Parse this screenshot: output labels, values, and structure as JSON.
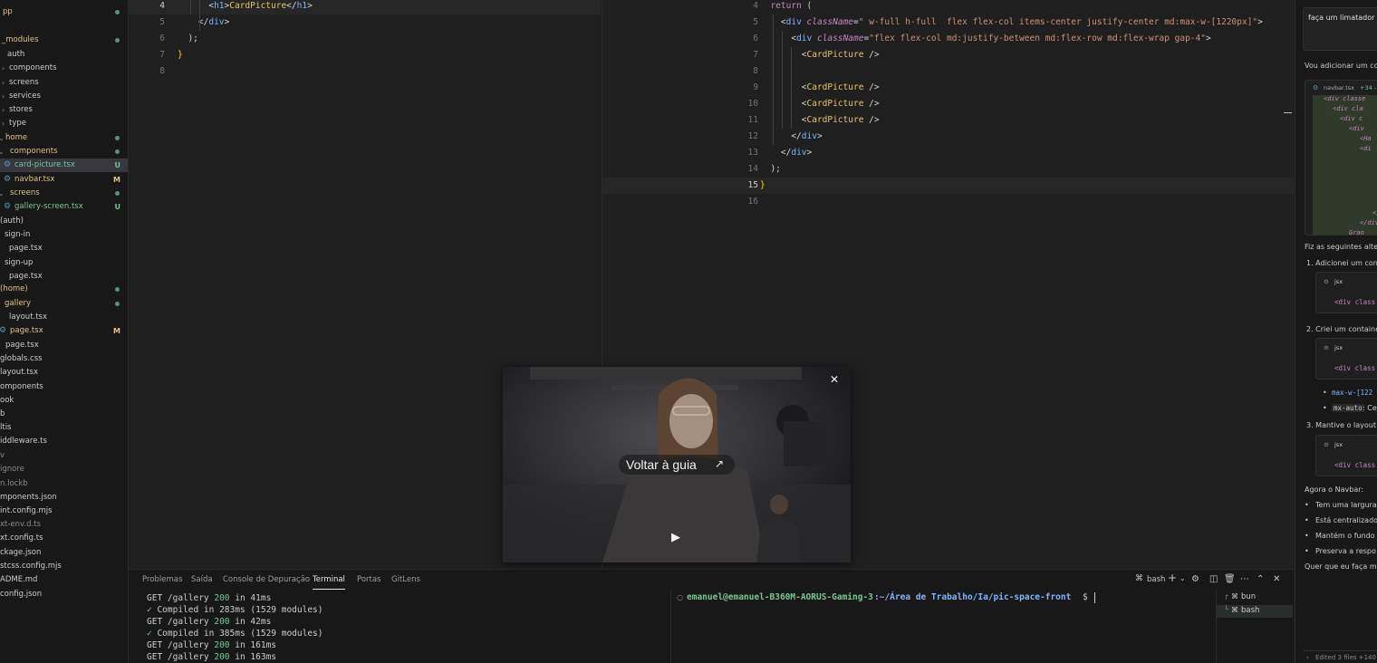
{
  "explorer": {
    "items": [
      {
        "label": "pp",
        "status": "dot"
      },
      {
        "label": "_modules",
        "status": "dot"
      },
      {
        "label": "auth",
        "chevron": "down"
      },
      {
        "label": "components",
        "chevron": "right"
      },
      {
        "label": "screens",
        "chevron": "right"
      },
      {
        "label": "services",
        "chevron": "right"
      },
      {
        "label": "stores",
        "chevron": "right"
      },
      {
        "label": "type",
        "chevron": "right"
      },
      {
        "label": "home",
        "chevron": "down",
        "status": "dot"
      },
      {
        "label": "components",
        "chevron": "down",
        "status": "dot"
      },
      {
        "label": "card-picture.tsx",
        "status": "U"
      },
      {
        "label": "navbar.tsx",
        "status": "M"
      },
      {
        "label": "screens",
        "chevron": "down",
        "status": "dot"
      },
      {
        "label": "gallery-screen.tsx",
        "status": "U"
      },
      {
        "label": "(auth)"
      },
      {
        "label": "sign-in",
        "chevron": "down"
      },
      {
        "label": "page.tsx"
      },
      {
        "label": "sign-up",
        "chevron": "down"
      },
      {
        "label": "page.tsx"
      },
      {
        "label": "(home)",
        "status": "dot"
      },
      {
        "label": "gallery",
        "status": "dot"
      },
      {
        "label": "layout.tsx"
      },
      {
        "label": "page.tsx",
        "status": "M"
      },
      {
        "label": "page.tsx"
      },
      {
        "label": "globals.css"
      },
      {
        "label": "layout.tsx"
      },
      {
        "label": "omponents"
      },
      {
        "label": "ook"
      },
      {
        "label": "b"
      },
      {
        "label": "ltis"
      },
      {
        "label": "iddleware.ts"
      },
      {
        "label": "v"
      },
      {
        "label": "ignore"
      },
      {
        "label": "n.lockb"
      },
      {
        "label": "mponents.json"
      },
      {
        "label": "int.config.mjs"
      },
      {
        "label": "xt-env.d.ts"
      },
      {
        "label": "xt.config.ts"
      },
      {
        "label": "ckage.json"
      },
      {
        "label": "stcss.config.mjs"
      },
      {
        "label": "ADME.md"
      },
      {
        "label": "config.json"
      }
    ]
  },
  "editor_left": {
    "lines": [
      {
        "n": "4",
        "tokens": [
          [
            "      ",
            ""
          ],
          [
            "<",
            "punc"
          ],
          [
            "h1",
            "tag"
          ],
          [
            ">",
            "punc"
          ],
          [
            "CardPicture",
            "text"
          ],
          [
            "</",
            "punc"
          ],
          [
            "h1",
            "tag"
          ],
          [
            ">",
            "punc"
          ]
        ]
      },
      {
        "n": "5",
        "tokens": [
          [
            "    ",
            ""
          ],
          [
            "</",
            "punc"
          ],
          [
            "div",
            "tag"
          ],
          [
            ">",
            "punc"
          ]
        ]
      },
      {
        "n": "6",
        "tokens": [
          [
            "  ",
            ""
          ],
          [
            ");",
            "punc"
          ]
        ]
      },
      {
        "n": "7",
        "tokens": [
          [
            "}",
            "brace"
          ]
        ]
      },
      {
        "n": "8",
        "tokens": []
      }
    ]
  },
  "editor_right": {
    "lines": [
      {
        "n": "4",
        "tokens": [
          [
            "  ",
            ""
          ],
          [
            "return",
            "kw"
          ],
          [
            " (",
            "punc"
          ]
        ]
      },
      {
        "n": "5",
        "tokens": [
          [
            "    ",
            ""
          ],
          [
            "<",
            "punc"
          ],
          [
            "div",
            "tag"
          ],
          [
            " ",
            ""
          ],
          [
            "className",
            "attr"
          ],
          [
            "=",
            "punc"
          ],
          [
            "\" w-full h-full  flex flex-col items-center justify-center md:max-w-[1220px]\"",
            "str"
          ],
          [
            ">",
            "punc"
          ]
        ]
      },
      {
        "n": "6",
        "tokens": [
          [
            "      ",
            ""
          ],
          [
            "<",
            "punc"
          ],
          [
            "div",
            "tag"
          ],
          [
            " ",
            ""
          ],
          [
            "className",
            "attr"
          ],
          [
            "=",
            "punc"
          ],
          [
            "\"flex flex-col md:justify-between md:flex-row md:flex-wrap gap-4\"",
            "str"
          ],
          [
            ">",
            "punc"
          ]
        ]
      },
      {
        "n": "7",
        "tokens": [
          [
            "        ",
            ""
          ],
          [
            "<",
            "punc"
          ],
          [
            "CardPicture",
            "comp"
          ],
          [
            " />",
            "punc"
          ]
        ]
      },
      {
        "n": "8",
        "tokens": []
      },
      {
        "n": "9",
        "tokens": [
          [
            "        ",
            ""
          ],
          [
            "<",
            "punc"
          ],
          [
            "CardPicture",
            "comp"
          ],
          [
            " />",
            "punc"
          ]
        ]
      },
      {
        "n": "10",
        "tokens": [
          [
            "        ",
            ""
          ],
          [
            "<",
            "punc"
          ],
          [
            "CardPicture",
            "comp"
          ],
          [
            " />",
            "punc"
          ]
        ]
      },
      {
        "n": "11",
        "tokens": [
          [
            "        ",
            ""
          ],
          [
            "<",
            "punc"
          ],
          [
            "CardPicture",
            "comp"
          ],
          [
            " />",
            "punc"
          ]
        ]
      },
      {
        "n": "12",
        "tokens": [
          [
            "      ",
            ""
          ],
          [
            "</",
            "punc"
          ],
          [
            "div",
            "tag"
          ],
          [
            ">",
            "punc"
          ]
        ]
      },
      {
        "n": "13",
        "tokens": [
          [
            "    ",
            ""
          ],
          [
            "</",
            "punc"
          ],
          [
            "div",
            "tag"
          ],
          [
            ">",
            "punc"
          ]
        ]
      },
      {
        "n": "14",
        "tokens": [
          [
            "  ",
            ""
          ],
          [
            ");",
            "punc"
          ]
        ]
      },
      {
        "n": "15",
        "tokens": [
          [
            "}",
            "brace"
          ]
        ]
      },
      {
        "n": "16",
        "tokens": []
      }
    ]
  },
  "panel": {
    "tabs": [
      "Problemas",
      "Saída",
      "Console de Depuração",
      "Terminal",
      "Portas",
      "GitLens"
    ],
    "active_tab": "Terminal",
    "shell_label": "bash",
    "terminal_left": [
      {
        "prefix": "GET /gallery ",
        "code": "200",
        "suffix": " in 41ms"
      },
      {
        "tick": "✓",
        "text": " Compiled in 283ms (1529 modules)"
      },
      {
        "prefix": "GET /gallery ",
        "code": "200",
        "suffix": " in 42ms"
      },
      {
        "tick": "✓",
        "text": " Compiled in 385ms (1529 modules)"
      },
      {
        "prefix": "GET /gallery ",
        "code": "200",
        "suffix": " in 161ms"
      },
      {
        "prefix": "GET /gallery ",
        "code": "200",
        "suffix": " in 163ms"
      }
    ],
    "terminal_right_prompt": {
      "user": "emanuel@emanuel-B360M-AORUS-Gaming-3",
      "path": ":~/Área de Trabalho/Ia/pic-space-front",
      "symbol": "$"
    },
    "terminal_list": [
      "bun",
      "bash"
    ]
  },
  "pip": {
    "overlay_label": "Voltar à guia"
  },
  "chat": {
    "prompt_text": "faça um limatador pa",
    "intro": "Vou adicionar um co",
    "file_chip": {
      "name": "navbar.tsx",
      "diff": "+34 -"
    },
    "code_preview": [
      "<div classe",
      "<div cla",
      "<div c",
      "<div",
      "<Ha",
      "<di",
      "</",
      "</div",
      "Gran"
    ],
    "summary_heading": "Fiz as seguintes alte",
    "steps": [
      {
        "label": "1. Adicionei um con",
        "lang": "jsx",
        "code": "<div class"
      },
      {
        "label": "2. Criei um containe",
        "lang": "jsx",
        "code": "<div class"
      },
      {
        "label": "3. Mantive o layout",
        "lang": "jsx",
        "code": "<div class"
      }
    ],
    "step2_bullets": [
      {
        "code": "max-w-[122",
        "text": ""
      },
      {
        "code": "mx-auto",
        "text": ": Ce"
      }
    ],
    "navbar_heading": "Agora o Navbar:",
    "navbar_bullets": [
      "Tem uma largura",
      "Está centralizado",
      "Mantém o fundo",
      "Preserva a respo"
    ],
    "closing": "Quer que eu faça m",
    "footer": "Edited 3 files +140"
  }
}
